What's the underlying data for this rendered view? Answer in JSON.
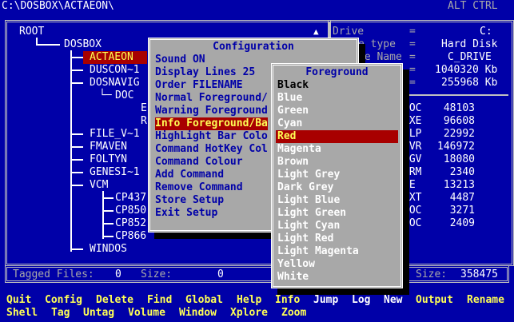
{
  "topbar": {
    "path": "C:\\DOSBOX\\ACTAEON\\",
    "mode": "ALT CTRL"
  },
  "tree": {
    "root": "ROOT",
    "items": [
      {
        "label": "DOSBOX"
      },
      {
        "label": "ACTAEON",
        "selected": true
      },
      {
        "label": "DUSCON~1"
      },
      {
        "label": "DOSNAVIG"
      },
      {
        "label": "DOC"
      },
      {
        "label": "E"
      },
      {
        "label": "R"
      },
      {
        "label": "FILE_V~1"
      },
      {
        "label": "FMAVEN"
      },
      {
        "label": "FOLTYN"
      },
      {
        "label": "GENESI~1"
      },
      {
        "label": "VCM"
      },
      {
        "label": "CP437"
      },
      {
        "label": "CP850"
      },
      {
        "label": "CP852"
      },
      {
        "label": "CP866"
      },
      {
        "label": "WINDOS"
      }
    ]
  },
  "drive_info": {
    "rows": [
      {
        "label": "Drive",
        "value": "C:"
      },
      {
        "label": "e type",
        "value": "Hard Disk"
      },
      {
        "label": "me Name",
        "value": "C_DRIVE"
      },
      {
        "label": "",
        "value": "1040320 Kb"
      },
      {
        "label": "",
        "value": "255968 Kb"
      }
    ],
    "eq": "="
  },
  "file_stats": [
    {
      "ext": "DOC",
      "size": "48103"
    },
    {
      "ext": "EXE",
      "size": "96608"
    },
    {
      "ext": "HLP",
      "size": "22992"
    },
    {
      "ext": "OVR",
      "size": "146972"
    },
    {
      "ext": "AGV",
      "size": "18080"
    },
    {
      "ext": "FRM",
      "size": "2340"
    },
    {
      "ext": "ME",
      "size": "13213"
    },
    {
      "ext": "TXT",
      "size": "4487"
    },
    {
      "ext": "DOC",
      "size": "3271"
    },
    {
      "ext": "DOC",
      "size": "2409"
    }
  ],
  "tagbar": {
    "tagged_label": "Tagged Files:",
    "tagged_count": "0",
    "size_label": "Size:",
    "size_value": "0",
    "right_size_label": "Size:",
    "right_size_value": "358475"
  },
  "config_menu": {
    "title": "Configuration",
    "items": [
      "Sound ON",
      "Display Lines 25",
      "Order FILENAME",
      "Normal Foreground/",
      "Warning Foreground",
      "Info Foreground/Ba",
      "HighLight Bar Colo",
      "Command HotKey Col",
      "Command Colour",
      "Add Command",
      "Remove Command",
      "Store Setup",
      "Exit Setup"
    ],
    "selected_index": 5
  },
  "foreground_menu": {
    "title": "Foreground",
    "items": [
      "Black",
      "Blue",
      "Green",
      "Cyan",
      "Red",
      "Magenta",
      "Brown",
      "Light Grey",
      "Dark Grey",
      "Light Blue",
      "Light Green",
      "Light Cyan",
      "Light Red",
      "Light Magenta",
      "Yellow",
      "White"
    ],
    "selected_index": 4
  },
  "menubar": {
    "row1": [
      "Quit",
      "Config",
      "Delete",
      "Find",
      "Global",
      "Help",
      "Info",
      "Jump",
      "Log",
      "New",
      "Output",
      "Rename"
    ],
    "row2": [
      "Shell",
      "Tag",
      "Untag",
      "Volume",
      "Window",
      "Xplore",
      "Zoom"
    ]
  },
  "colors": {
    "background": "#0000a8",
    "highlight": "#a80000",
    "menu_gray": "#a8a8a8",
    "hotkey_yellow": "#ffff55"
  }
}
